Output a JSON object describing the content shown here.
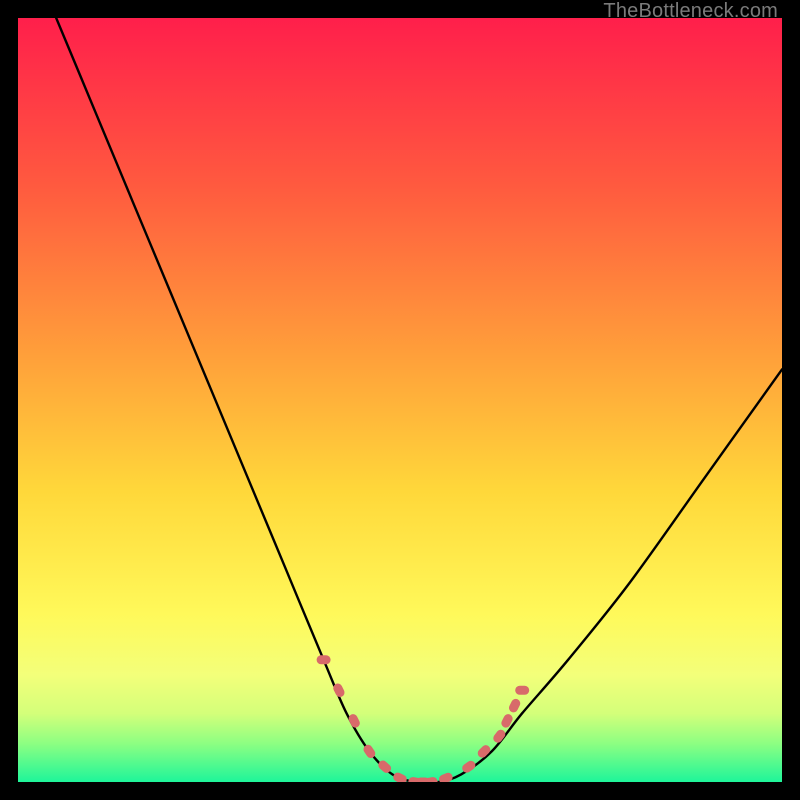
{
  "watermark": "TheBottleneck.com",
  "colors": {
    "gradient_top": "#ff1f4b",
    "gradient_mid_upper": "#ff7a3a",
    "gradient_mid": "#ffd83a",
    "gradient_lower": "#f7ff6b",
    "gradient_bottom1": "#b6ff6b",
    "gradient_bottom2": "#2bff93",
    "curve_stroke": "#000000",
    "marker_fill": "#d86a6a",
    "background": "#000000"
  },
  "chart_data": {
    "type": "line",
    "title": "",
    "xlabel": "",
    "ylabel": "",
    "xlim": [
      0,
      100
    ],
    "ylim": [
      0,
      100
    ],
    "series": [
      {
        "name": "bottleneck-curve",
        "x": [
          5,
          10,
          15,
          20,
          25,
          30,
          35,
          40,
          43,
          46,
          49,
          52,
          55,
          58,
          62,
          66,
          72,
          80,
          90,
          100
        ],
        "y": [
          100,
          88,
          76,
          64,
          52,
          40,
          28,
          16,
          9,
          4,
          1,
          0,
          0,
          1,
          4,
          9,
          16,
          26,
          40,
          54
        ]
      }
    ],
    "markers": {
      "name": "highlight-segment",
      "x": [
        40,
        42,
        44,
        46,
        48,
        50,
        52,
        53,
        54,
        56,
        59,
        61,
        63,
        64,
        65,
        66
      ],
      "y": [
        16,
        12,
        8,
        4,
        2,
        0.5,
        0,
        0,
        0,
        0.5,
        2,
        4,
        6,
        8,
        10,
        12
      ]
    }
  }
}
